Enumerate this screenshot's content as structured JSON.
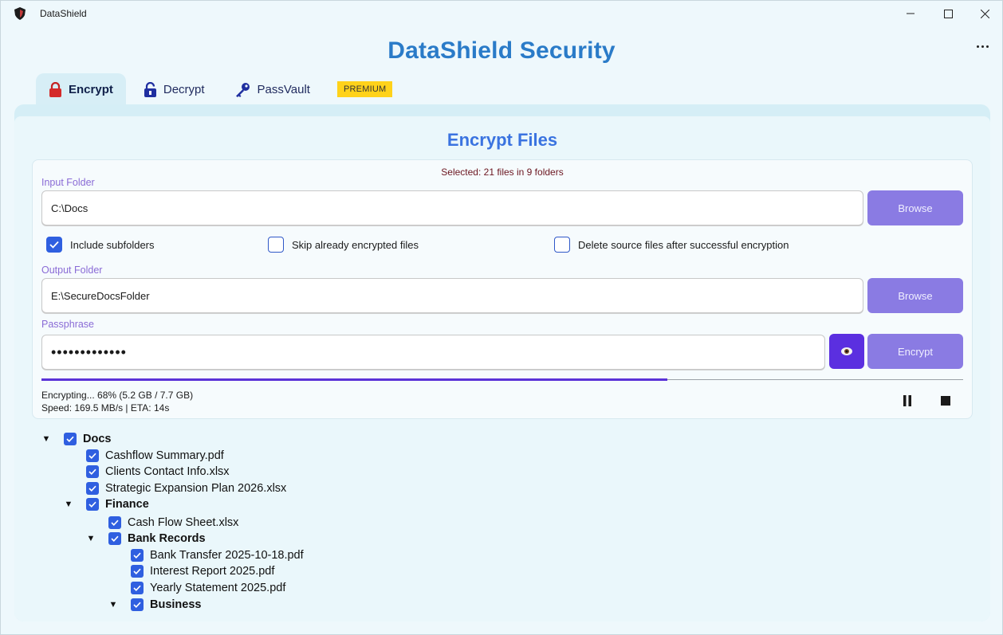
{
  "window": {
    "title": "DataShield"
  },
  "header": {
    "title": "DataShield Security"
  },
  "tabs": [
    {
      "label": "Encrypt",
      "icon": "lock-icon",
      "active": true
    },
    {
      "label": "Decrypt",
      "icon": "unlock-icon",
      "active": false
    },
    {
      "label": "PassVault",
      "icon": "key-icon",
      "active": false
    }
  ],
  "premium_badge": "PREMIUM",
  "encrypt": {
    "title": "Encrypt Files",
    "selected_summary": "Selected: 21 files in 9 folders",
    "input_folder": {
      "label": "Input Folder",
      "value": "C:\\Docs",
      "browse_label": "Browse"
    },
    "options": [
      {
        "label": "Include subfolders",
        "checked": true
      },
      {
        "label": "Skip already encrypted files",
        "checked": false
      },
      {
        "label": "Delete source files after successful encryption",
        "checked": false
      }
    ],
    "output_folder": {
      "label": "Output Folder",
      "value": "E:\\SecureDocsFolder",
      "browse_label": "Browse"
    },
    "passphrase": {
      "label": "Passphrase",
      "masked_value": "•••••••••••••",
      "show_icon": "eye-icon"
    },
    "encrypt_label": "Encrypt",
    "progress": {
      "percent": 68,
      "status": "Encrypting... 68% (5.2 GB / 7.7 GB)",
      "speed": "Speed: 169.5 MB/s | ETA: 14s"
    }
  },
  "tree": [
    {
      "name": "Docs",
      "type": "folder",
      "depth": 0,
      "checked": true,
      "expanded": true
    },
    {
      "name": "Cashflow Summary.pdf",
      "type": "file",
      "depth": 1,
      "checked": true
    },
    {
      "name": "Clients Contact Info.xlsx",
      "type": "file",
      "depth": 1,
      "checked": true
    },
    {
      "name": "Strategic Expansion Plan 2026.xlsx",
      "type": "file",
      "depth": 1,
      "checked": true
    },
    {
      "name": "Finance",
      "type": "folder",
      "depth": 1,
      "checked": true,
      "expanded": true
    },
    {
      "name": "Cash Flow Sheet.xlsx",
      "type": "file",
      "depth": 2,
      "checked": true
    },
    {
      "name": "Bank Records",
      "type": "folder",
      "depth": 2,
      "checked": true,
      "expanded": true
    },
    {
      "name": "Bank Transfer 2025-10-18.pdf",
      "type": "file",
      "depth": 3,
      "checked": true
    },
    {
      "name": "Interest Report 2025.pdf",
      "type": "file",
      "depth": 3,
      "checked": true
    },
    {
      "name": "Yearly Statement 2025.pdf",
      "type": "file",
      "depth": 3,
      "checked": true
    },
    {
      "name": "Business",
      "type": "folder",
      "depth": 3,
      "checked": true,
      "expanded": true
    }
  ],
  "colors": {
    "accent": "#2a7bc8",
    "button": "#8a7be3",
    "progress": "#5a32d8",
    "checkbox": "#2f5fe0",
    "premium": "#ffd21a"
  }
}
